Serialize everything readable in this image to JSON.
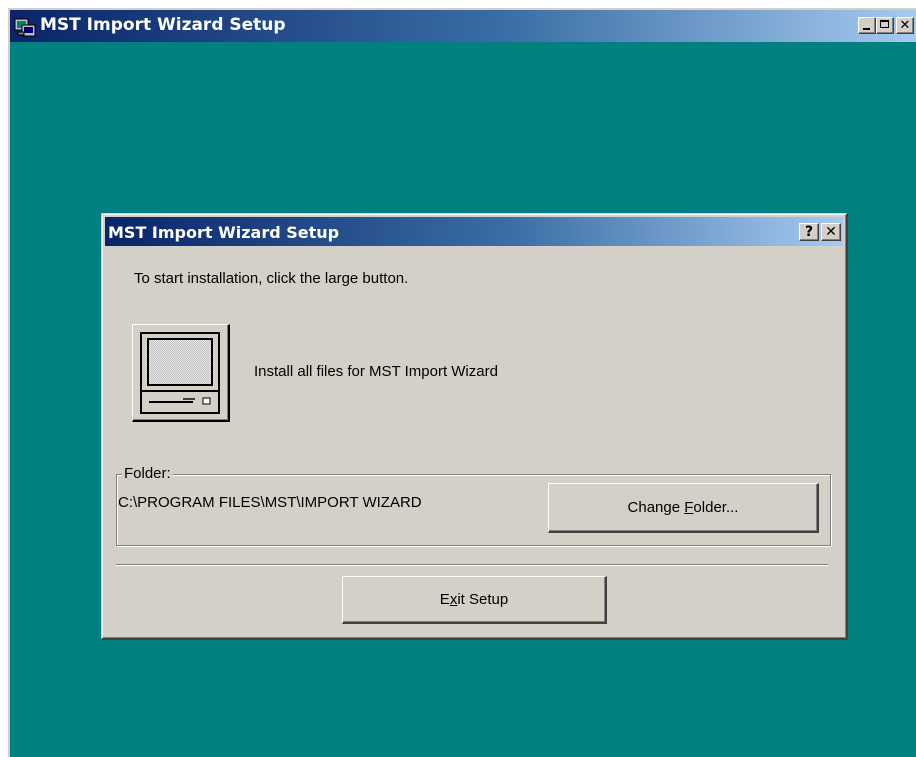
{
  "outer_window": {
    "title": "MST Import Wizard Setup",
    "icon": "setup-computer-icon"
  },
  "dialog": {
    "title": "MST Import Wizard Setup",
    "help_button": "?",
    "close_button": "×",
    "instruction": "To start installation, click the large button.",
    "install_button_icon": "computer-monitor-icon",
    "install_label": "Install all files for MST Import Wizard",
    "folder_group": {
      "legend": "Folder:",
      "path": "C:\\PROGRAM FILES\\MST\\IMPORT WIZARD",
      "change_button": {
        "prefix": "Change ",
        "mnemonic": "F",
        "suffix": "older..."
      }
    },
    "exit_button": {
      "prefix": "E",
      "mnemonic": "x",
      "suffix": "it Setup"
    }
  },
  "colors": {
    "desktop_teal": "#008080",
    "title_bar_start": "#0a246a",
    "title_bar_end": "#a6caf0",
    "face": "#d4d0c8"
  }
}
